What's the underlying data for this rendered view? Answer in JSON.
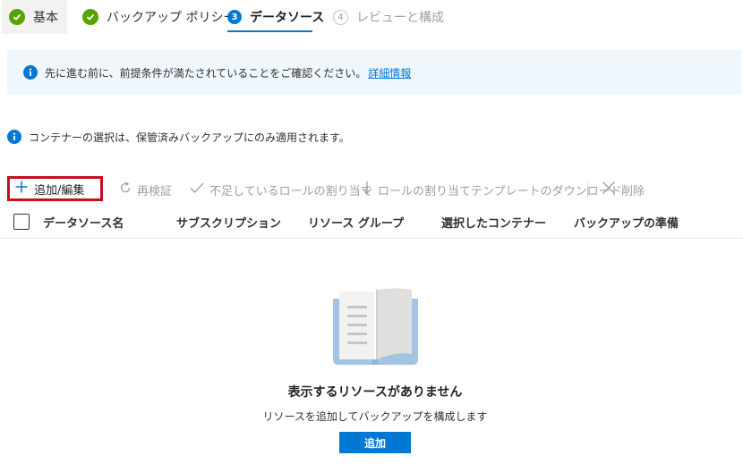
{
  "steps": [
    {
      "number": "1",
      "label": "基本",
      "state": "completed"
    },
    {
      "number": "2",
      "label": "バックアップ ポリシー",
      "state": "completed"
    },
    {
      "number": "3",
      "label": "データソース",
      "state": "current"
    },
    {
      "number": "4",
      "label": "レビューと構成",
      "state": "disabled"
    }
  ],
  "banner": {
    "text": "先に進む前に、前提条件が満たされていることをご確認ください。",
    "link": "詳細情報"
  },
  "note": "コンテナーの選択は、保管済みバックアップにのみ適用されます。",
  "toolbar": {
    "add_edit": "追加/編集",
    "revalidate": "再検証",
    "assign_missing_roles": "不足しているロールの割り当て",
    "download_template": "ロールの割り当てテンプレートのダウンロード",
    "delete": "削除"
  },
  "table": {
    "columns": [
      "データソース名",
      "サブスクリプション",
      "リソース グループ",
      "選択したコンテナー",
      "バックアップの準備"
    ]
  },
  "empty_state": {
    "title": "表示するリソースがありません",
    "subtitle": "リソースを追加してバックアップを構成します",
    "button": "追加"
  },
  "colors": {
    "accent": "#0078d4",
    "success": "#57a300",
    "highlight_border": "#c50f1f",
    "banner_bg": "#eff6fc"
  }
}
